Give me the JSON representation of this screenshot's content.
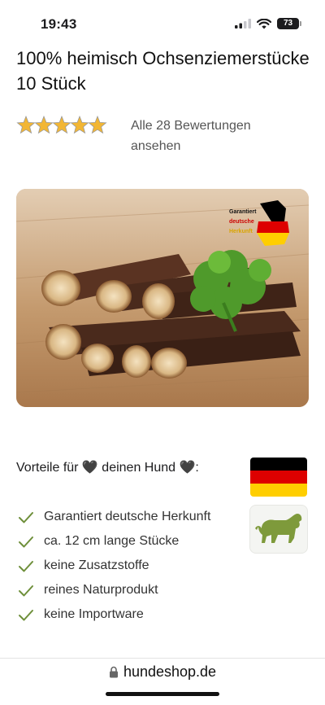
{
  "status_bar": {
    "time": "19:43",
    "battery": "73"
  },
  "product": {
    "title": "100% heimisch Ochsenziemerstücke 10 Stück",
    "rating": {
      "stars": 5,
      "reviews_link": "Alle 28 Bewertungen ansehen"
    },
    "image": {
      "badge_lines": [
        "Garantiert",
        "deutsche",
        "Herkunft"
      ]
    }
  },
  "benefits": {
    "heading": "Vorteile für 🖤 deinen Hund 🖤:",
    "items": [
      "Garantiert deutsche Herkunft",
      "ca. 12 cm lange Stücke",
      "keine Zusatzstoffe",
      "reines Naturprodukt",
      "keine Importware"
    ]
  },
  "browser": {
    "url": "hundeshop.de"
  },
  "colors": {
    "check": "#6e8f3a",
    "star": "#f2b634",
    "dog": "#7e9a3b",
    "flag_black": "#000000",
    "flag_red": "#dd0000",
    "flag_gold": "#ffce00"
  }
}
